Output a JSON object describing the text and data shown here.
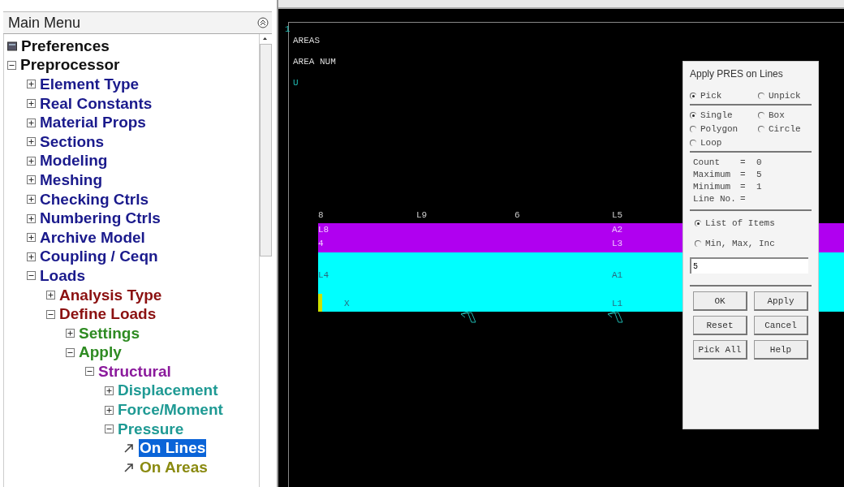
{
  "main_menu": {
    "title": "Main Menu",
    "tree": [
      {
        "label": "Preferences",
        "kind": "settings"
      },
      {
        "label": "Preprocessor",
        "kind": "branch",
        "expanded": true,
        "children": [
          {
            "label": "Element Type",
            "kind": "branch",
            "expanded": false
          },
          {
            "label": "Real Constants",
            "kind": "branch",
            "expanded": false
          },
          {
            "label": "Material Props",
            "kind": "branch",
            "expanded": false
          },
          {
            "label": "Sections",
            "kind": "branch",
            "expanded": false
          },
          {
            "label": "Modeling",
            "kind": "branch",
            "expanded": false
          },
          {
            "label": "Meshing",
            "kind": "branch",
            "expanded": false
          },
          {
            "label": "Checking Ctrls",
            "kind": "branch",
            "expanded": false
          },
          {
            "label": "Numbering Ctrls",
            "kind": "branch",
            "expanded": false
          },
          {
            "label": "Archive Model",
            "kind": "branch",
            "expanded": false
          },
          {
            "label": "Coupling / Ceqn",
            "kind": "branch",
            "expanded": false
          },
          {
            "label": "Loads",
            "kind": "branch",
            "expanded": true,
            "children": [
              {
                "label": "Analysis Type",
                "kind": "branch",
                "expanded": false
              },
              {
                "label": "Define Loads",
                "kind": "branch",
                "expanded": true,
                "children": [
                  {
                    "label": "Settings",
                    "kind": "branch",
                    "expanded": false
                  },
                  {
                    "label": "Apply",
                    "kind": "branch",
                    "expanded": true,
                    "children": [
                      {
                        "label": "Structural",
                        "kind": "branch",
                        "expanded": true,
                        "children": [
                          {
                            "label": "Displacement",
                            "kind": "branch",
                            "expanded": false
                          },
                          {
                            "label": "Force/Moment",
                            "kind": "branch",
                            "expanded": false
                          },
                          {
                            "label": "Pressure",
                            "kind": "branch",
                            "expanded": true,
                            "children": [
                              {
                                "label": "On Lines",
                                "kind": "leaf",
                                "selected": true
                              },
                              {
                                "label": "On Areas",
                                "kind": "leaf",
                                "selected": false
                              }
                            ]
                          }
                        ]
                      }
                    ]
                  }
                ]
              }
            ]
          }
        ]
      }
    ]
  },
  "graphics": {
    "header": [
      "1",
      "AREAS",
      "AREA NUM",
      "U"
    ],
    "top_labels": [
      "8",
      "L9",
      "6",
      "L5"
    ],
    "upper_area_labels": [
      "L8",
      "4",
      "A2",
      "L3"
    ],
    "lower_area_labels": [
      "L4",
      "X",
      "A1",
      "L1"
    ]
  },
  "dialog": {
    "title": "Apply PRES on Lines",
    "pick_modes": [
      {
        "label": "Pick",
        "selected": true
      },
      {
        "label": "Unpick",
        "selected": false
      }
    ],
    "pick_shapes": [
      {
        "label": "Single",
        "selected": true
      },
      {
        "label": "Box",
        "selected": false
      },
      {
        "label": "Polygon",
        "selected": false
      },
      {
        "label": "Circle",
        "selected": false
      },
      {
        "label": "Loop",
        "selected": false
      }
    ],
    "stats": [
      {
        "label": "Count",
        "sign": "=",
        "value": "0"
      },
      {
        "label": "Maximum",
        "sign": "=",
        "value": "5"
      },
      {
        "label": "Minimum",
        "sign": "=",
        "value": "1"
      },
      {
        "label": "Line No.",
        "sign": "="
      }
    ],
    "entry_modes": [
      {
        "label": "List of Items",
        "selected": true
      },
      {
        "label": "Min, Max, Inc",
        "selected": false
      }
    ],
    "input": {
      "value": "5"
    },
    "buttons": [
      "OK",
      "Apply",
      "Reset",
      "Cancel",
      "Pick All",
      "Help"
    ]
  }
}
